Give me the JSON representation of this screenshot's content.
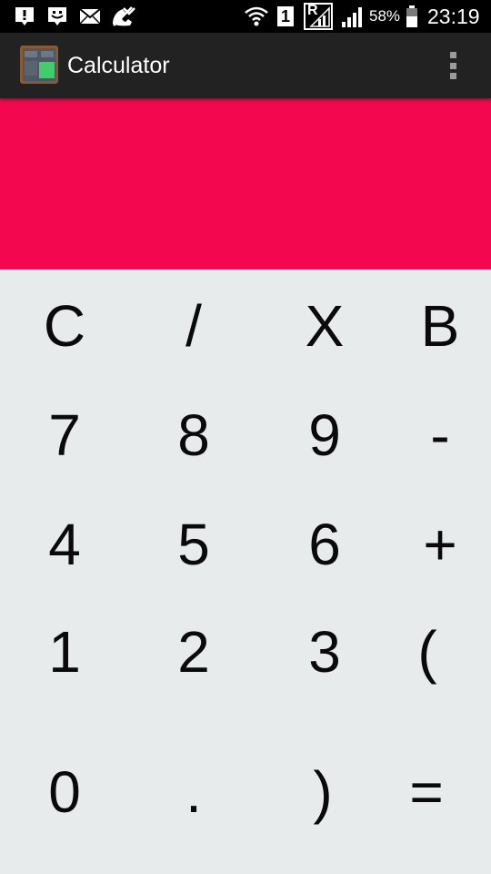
{
  "status_bar": {
    "icons": [
      "alert-box-icon",
      "smiley-notification-icon",
      "mail-icon",
      "missed-call-icon",
      "wifi-icon",
      "sim1-icon",
      "roaming-signal-icon",
      "signal-bars-icon",
      "battery-icon"
    ],
    "sim_label": "1",
    "roaming_label": "R",
    "battery": "58%",
    "time": "23:19"
  },
  "action_bar": {
    "title": "Calculator",
    "app_icon": "calculator-app-icon",
    "menu_icon": "overflow-menu-icon"
  },
  "display": {
    "value": "",
    "background": "#f3074e"
  },
  "keypad": {
    "rows": [
      [
        "C",
        "/",
        "X",
        "B"
      ],
      [
        "7",
        "8",
        "9",
        "-"
      ],
      [
        "4",
        "5",
        "6",
        "+"
      ],
      [
        "1",
        "2",
        "3",
        "("
      ],
      [
        "0",
        ".",
        ")",
        "="
      ]
    ]
  }
}
